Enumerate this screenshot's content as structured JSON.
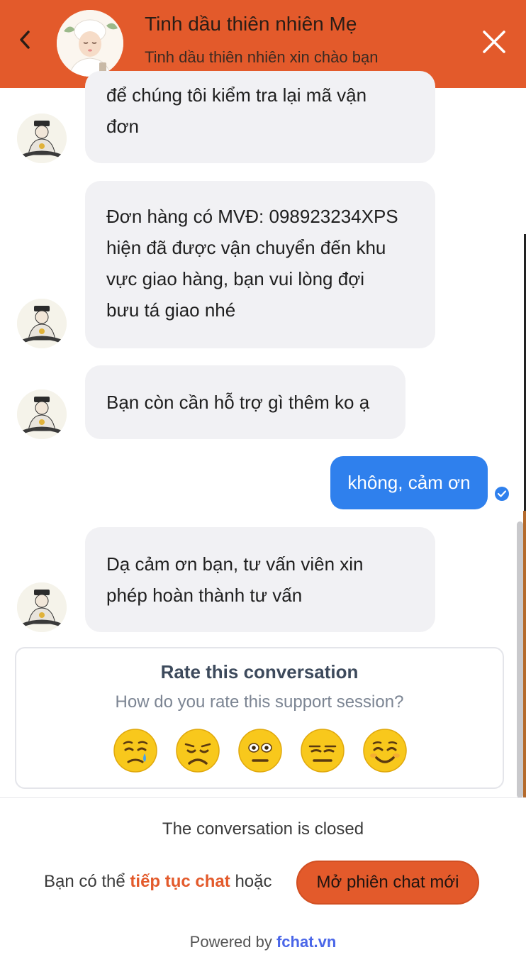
{
  "header": {
    "title": "Tinh dầu thiên nhiên Mẹ",
    "subtitle": "Tinh dầu thiên nhiên xin chào bạn",
    "accent_color": "#e35a2b",
    "back_icon": "chevron-left-icon",
    "close_icon": "close-icon"
  },
  "messages": [
    {
      "from": "agent",
      "lines": [
        "để chúng tôi kiểm tra lại mã vận",
        "đơn"
      ]
    },
    {
      "from": "agent",
      "lines": [
        "Đơn hàng có MVĐ: 098923234XPS",
        "hiện đã được vận chuyển đến khu",
        "vực giao hàng, bạn vui lòng đợi",
        "bưu tá giao nhé"
      ]
    },
    {
      "from": "agent",
      "lines": [
        "Bạn còn cần hỗ trợ gì thêm ko ạ"
      ]
    },
    {
      "from": "user",
      "text": "không, cảm ơn",
      "status_icon": "seen-check-icon"
    },
    {
      "from": "agent",
      "lines": [
        "Dạ cảm ơn bạn, tư vấn viên xin",
        "phép hoàn thành tư vấn"
      ]
    }
  ],
  "rating": {
    "title": "Rate this conversation",
    "subtitle": "How do you rate this support session?",
    "options": [
      "crying-face-icon",
      "frowning-face-icon",
      "flushed-face-icon",
      "expressionless-face-icon",
      "smiling-face-icon"
    ]
  },
  "footer": {
    "closed_text": "The conversation is closed",
    "continue_prefix": "Bạn có thể ",
    "continue_link": "tiếp tục chat",
    "continue_suffix": " hoặc",
    "new_chat_button": "Mở phiên chat mới",
    "powered_prefix": "Powered by ",
    "powered_link": "fchat.vn"
  }
}
